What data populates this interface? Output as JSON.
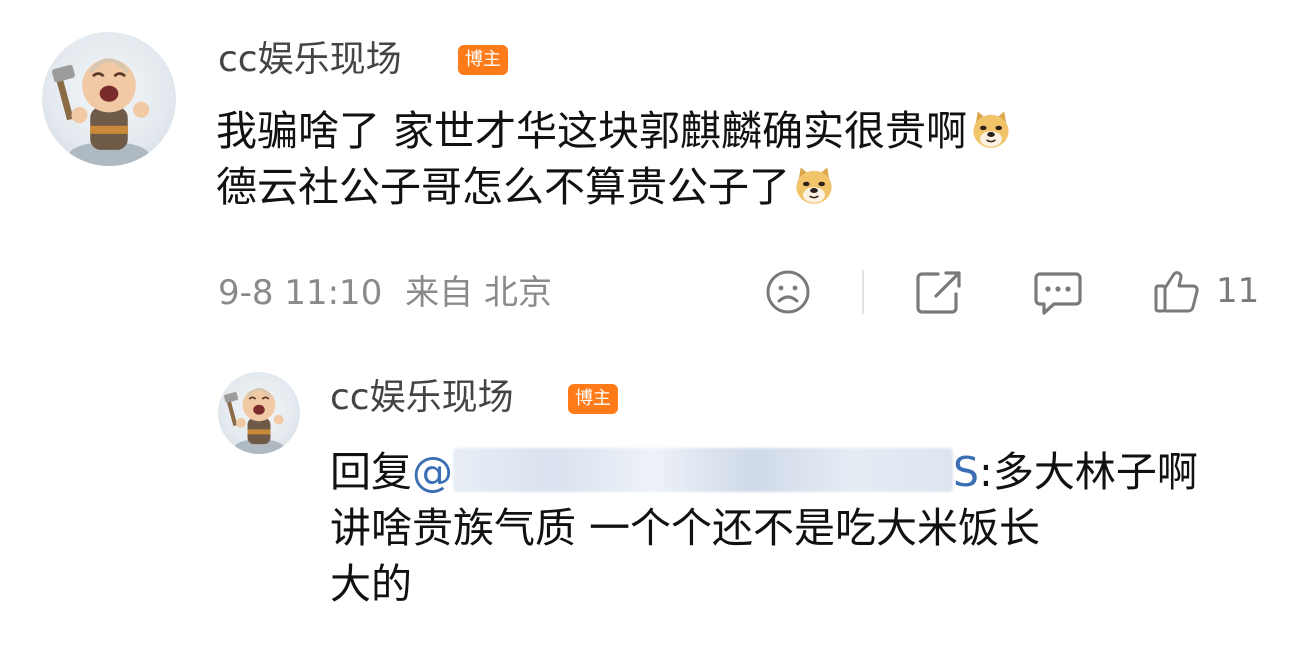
{
  "comment": {
    "username": "cc娱乐现场",
    "badge": "博主",
    "line1": "我骗啥了 家世才华这块郭麒麟确实很贵啊",
    "line2": "德云社公子哥怎么不算贵公子了",
    "emoji_icon": "doge-emoji-icon",
    "timestamp": "9-8 11:10",
    "location": "来自 北京",
    "like_count": "11",
    "icons": [
      "frown-icon",
      "share-icon",
      "comment-icon",
      "thumbs-up-icon"
    ]
  },
  "reply": {
    "username": "cc娱乐现场",
    "badge": "博主",
    "prefix": "回复",
    "mention_start": "@",
    "mention_end": "S",
    "line1_rest": ":多大林子啊",
    "line2": "讲啥贵族气质 一个个还不是吃大米饭长",
    "line3": "大的"
  },
  "colors": {
    "badge": "#ff7b1a",
    "mention": "#3a6fb5",
    "meta": "#8a8a8a"
  }
}
